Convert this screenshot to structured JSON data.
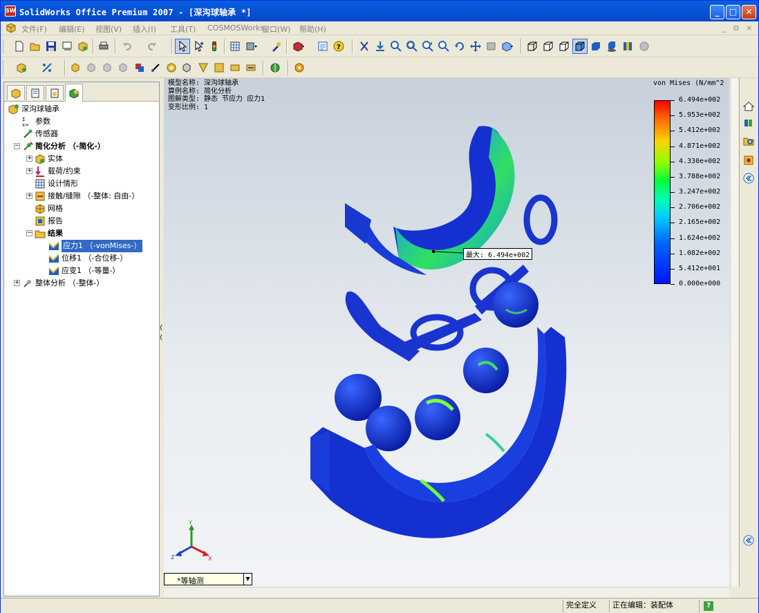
{
  "window": {
    "title": "SolidWorks Office Premium 2007 - [深沟球轴承 *]",
    "app_icon_label": "SW"
  },
  "window_buttons": {
    "minimize": "_",
    "maximize": "□",
    "close": "✕"
  },
  "menu": {
    "items": [
      "文件(F)",
      "编辑(E)",
      "视图(V)",
      "插入(I)",
      "工具(T)",
      "COSMOSWorks",
      "窗口(W)",
      "帮助(H)"
    ],
    "doc_controls": [
      "_",
      "⧉",
      "×"
    ]
  },
  "feature_tree": {
    "root": "深沟球轴承",
    "items": [
      {
        "label": "参数",
        "icon": "params-icon"
      },
      {
        "label": "传感器",
        "icon": "sensor-icon"
      },
      {
        "label": "简化分析 （-简化-）",
        "icon": "study-icon"
      },
      {
        "label": "实体",
        "icon": "solids-icon"
      },
      {
        "label": "载荷/约束",
        "icon": "loads-icon"
      },
      {
        "label": "设计情形",
        "icon": "design-scenario-icon"
      },
      {
        "label": "接触/缝隙 （-整体: 自由-）",
        "icon": "contact-icon"
      },
      {
        "label": "网格",
        "icon": "mesh-icon"
      },
      {
        "label": "报告",
        "icon": "report-icon"
      },
      {
        "label": "结果",
        "icon": "results-folder-icon"
      },
      {
        "label": "应力1 （-vonMises-）",
        "icon": "stress-plot-icon"
      },
      {
        "label": "位移1 （-合位移-）",
        "icon": "displacement-plot-icon"
      },
      {
        "label": "应变1 （-等量-）",
        "icon": "strain-plot-icon"
      },
      {
        "label": "整体分析 （-整体-）",
        "icon": "study-icon"
      }
    ]
  },
  "plot_info": {
    "model_name": "模型名称: 深沟球轴承",
    "study_name": "算例名称: 简化分析",
    "plot_type": "图解类型: 静态 节应力 应力1",
    "deform_scale": "变形比例: 1"
  },
  "legend": {
    "title": "von Mises (N/mm^2",
    "values": [
      "6.494e+002",
      "5.953e+002",
      "5.412e+002",
      "4.871e+002",
      "4.330e+002",
      "3.788e+002",
      "3.247e+002",
      "2.706e+002",
      "2.165e+002",
      "1.624e+002",
      "1.082e+002",
      "5.412e+001",
      "0.000e+000"
    ]
  },
  "max_annotation": "最大: 6.494e+002",
  "triad": {
    "x": "X",
    "y": "Y",
    "z": "Z"
  },
  "view_selector": {
    "value": "*等轴测"
  },
  "status_bar": {
    "definition": "完全定义",
    "editing": "正在编辑：装配体",
    "help": "?"
  },
  "colors": {
    "titlebar": "#0a5ee0",
    "max_stress": "#ff0000",
    "min_stress": "#0014ff",
    "part_blue": "#1f3fd0",
    "selection": "#316ac5"
  }
}
